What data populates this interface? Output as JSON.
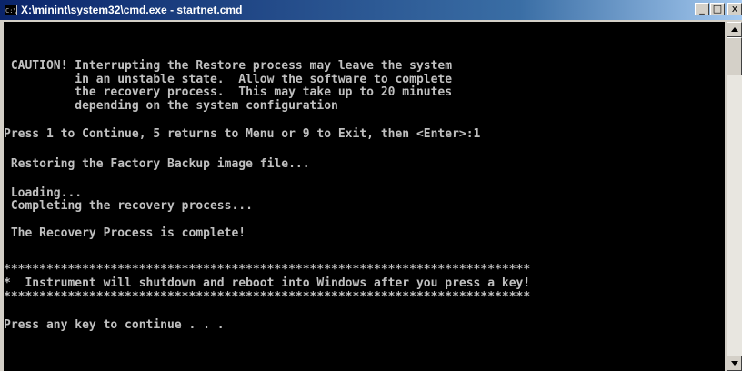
{
  "window": {
    "title": "X:\\minint\\system32\\cmd.exe - startnet.cmd",
    "icon": "cmd-console-icon",
    "icon_text": "C:\\",
    "controls": {
      "minimize": "_",
      "maximize": "□",
      "close": "x"
    }
  },
  "console": {
    "lines": [
      " CAUTION! Interrupting the Restore process may leave the system",
      "          in an unstable state.  Allow the software to complete",
      "          the recovery process.  This may take up to 20 minutes",
      "          depending on the system configuration",
      "Press 1 to Continue, 5 returns to Menu or 9 to Exit, then <Enter>:1",
      " Restoring the Factory Backup image file...",
      " Loading...",
      " Completing the recovery process...",
      " The Recovery Process is complete!",
      "**************************************************************************",
      "*  Instrument will shutdown and reboot into Windows after you press a key!",
      "**************************************************************************",
      "Press any key to continue . . ."
    ]
  },
  "colors": {
    "console_bg": "#000000",
    "console_text": "#c0c0c0",
    "titlebar_start": "#0a246a",
    "titlebar_end": "#a6caf0"
  }
}
